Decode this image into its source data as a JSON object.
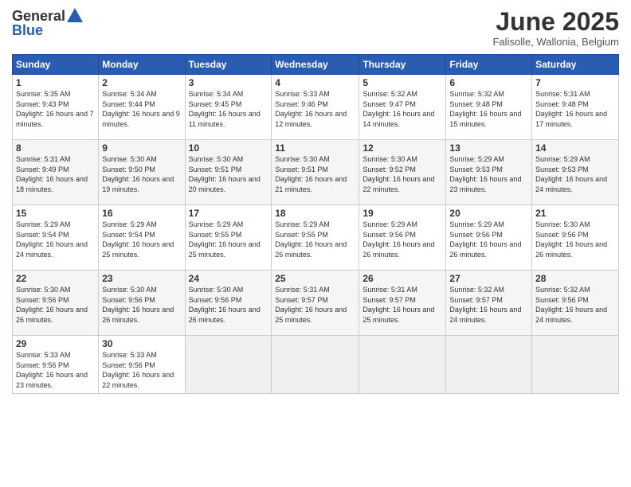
{
  "header": {
    "logo_general": "General",
    "logo_blue": "Blue",
    "month_title": "June 2025",
    "location": "Falisolle, Wallonia, Belgium"
  },
  "days_of_week": [
    "Sunday",
    "Monday",
    "Tuesday",
    "Wednesday",
    "Thursday",
    "Friday",
    "Saturday"
  ],
  "weeks": [
    [
      {
        "day": "1",
        "sunrise": "Sunrise: 5:35 AM",
        "sunset": "Sunset: 9:43 PM",
        "daylight": "Daylight: 16 hours and 7 minutes."
      },
      {
        "day": "2",
        "sunrise": "Sunrise: 5:34 AM",
        "sunset": "Sunset: 9:44 PM",
        "daylight": "Daylight: 16 hours and 9 minutes."
      },
      {
        "day": "3",
        "sunrise": "Sunrise: 5:34 AM",
        "sunset": "Sunset: 9:45 PM",
        "daylight": "Daylight: 16 hours and 11 minutes."
      },
      {
        "day": "4",
        "sunrise": "Sunrise: 5:33 AM",
        "sunset": "Sunset: 9:46 PM",
        "daylight": "Daylight: 16 hours and 12 minutes."
      },
      {
        "day": "5",
        "sunrise": "Sunrise: 5:32 AM",
        "sunset": "Sunset: 9:47 PM",
        "daylight": "Daylight: 16 hours and 14 minutes."
      },
      {
        "day": "6",
        "sunrise": "Sunrise: 5:32 AM",
        "sunset": "Sunset: 9:48 PM",
        "daylight": "Daylight: 16 hours and 15 minutes."
      },
      {
        "day": "7",
        "sunrise": "Sunrise: 5:31 AM",
        "sunset": "Sunset: 9:48 PM",
        "daylight": "Daylight: 16 hours and 17 minutes."
      }
    ],
    [
      {
        "day": "8",
        "sunrise": "Sunrise: 5:31 AM",
        "sunset": "Sunset: 9:49 PM",
        "daylight": "Daylight: 16 hours and 18 minutes."
      },
      {
        "day": "9",
        "sunrise": "Sunrise: 5:30 AM",
        "sunset": "Sunset: 9:50 PM",
        "daylight": "Daylight: 16 hours and 19 minutes."
      },
      {
        "day": "10",
        "sunrise": "Sunrise: 5:30 AM",
        "sunset": "Sunset: 9:51 PM",
        "daylight": "Daylight: 16 hours and 20 minutes."
      },
      {
        "day": "11",
        "sunrise": "Sunrise: 5:30 AM",
        "sunset": "Sunset: 9:51 PM",
        "daylight": "Daylight: 16 hours and 21 minutes."
      },
      {
        "day": "12",
        "sunrise": "Sunrise: 5:30 AM",
        "sunset": "Sunset: 9:52 PM",
        "daylight": "Daylight: 16 hours and 22 minutes."
      },
      {
        "day": "13",
        "sunrise": "Sunrise: 5:29 AM",
        "sunset": "Sunset: 9:53 PM",
        "daylight": "Daylight: 16 hours and 23 minutes."
      },
      {
        "day": "14",
        "sunrise": "Sunrise: 5:29 AM",
        "sunset": "Sunset: 9:53 PM",
        "daylight": "Daylight: 16 hours and 24 minutes."
      }
    ],
    [
      {
        "day": "15",
        "sunrise": "Sunrise: 5:29 AM",
        "sunset": "Sunset: 9:54 PM",
        "daylight": "Daylight: 16 hours and 24 minutes."
      },
      {
        "day": "16",
        "sunrise": "Sunrise: 5:29 AM",
        "sunset": "Sunset: 9:54 PM",
        "daylight": "Daylight: 16 hours and 25 minutes."
      },
      {
        "day": "17",
        "sunrise": "Sunrise: 5:29 AM",
        "sunset": "Sunset: 9:55 PM",
        "daylight": "Daylight: 16 hours and 25 minutes."
      },
      {
        "day": "18",
        "sunrise": "Sunrise: 5:29 AM",
        "sunset": "Sunset: 9:55 PM",
        "daylight": "Daylight: 16 hours and 26 minutes."
      },
      {
        "day": "19",
        "sunrise": "Sunrise: 5:29 AM",
        "sunset": "Sunset: 9:56 PM",
        "daylight": "Daylight: 16 hours and 26 minutes."
      },
      {
        "day": "20",
        "sunrise": "Sunrise: 5:29 AM",
        "sunset": "Sunset: 9:56 PM",
        "daylight": "Daylight: 16 hours and 26 minutes."
      },
      {
        "day": "21",
        "sunrise": "Sunrise: 5:30 AM",
        "sunset": "Sunset: 9:56 PM",
        "daylight": "Daylight: 16 hours and 26 minutes."
      }
    ],
    [
      {
        "day": "22",
        "sunrise": "Sunrise: 5:30 AM",
        "sunset": "Sunset: 9:56 PM",
        "daylight": "Daylight: 16 hours and 26 minutes."
      },
      {
        "day": "23",
        "sunrise": "Sunrise: 5:30 AM",
        "sunset": "Sunset: 9:56 PM",
        "daylight": "Daylight: 16 hours and 26 minutes."
      },
      {
        "day": "24",
        "sunrise": "Sunrise: 5:30 AM",
        "sunset": "Sunset: 9:56 PM",
        "daylight": "Daylight: 16 hours and 26 minutes."
      },
      {
        "day": "25",
        "sunrise": "Sunrise: 5:31 AM",
        "sunset": "Sunset: 9:57 PM",
        "daylight": "Daylight: 16 hours and 25 minutes."
      },
      {
        "day": "26",
        "sunrise": "Sunrise: 5:31 AM",
        "sunset": "Sunset: 9:57 PM",
        "daylight": "Daylight: 16 hours and 25 minutes."
      },
      {
        "day": "27",
        "sunrise": "Sunrise: 5:32 AM",
        "sunset": "Sunset: 9:57 PM",
        "daylight": "Daylight: 16 hours and 24 minutes."
      },
      {
        "day": "28",
        "sunrise": "Sunrise: 5:32 AM",
        "sunset": "Sunset: 9:56 PM",
        "daylight": "Daylight: 16 hours and 24 minutes."
      }
    ],
    [
      {
        "day": "29",
        "sunrise": "Sunrise: 5:33 AM",
        "sunset": "Sunset: 9:56 PM",
        "daylight": "Daylight: 16 hours and 23 minutes."
      },
      {
        "day": "30",
        "sunrise": "Sunrise: 5:33 AM",
        "sunset": "Sunset: 9:56 PM",
        "daylight": "Daylight: 16 hours and 22 minutes."
      },
      null,
      null,
      null,
      null,
      null
    ]
  ]
}
